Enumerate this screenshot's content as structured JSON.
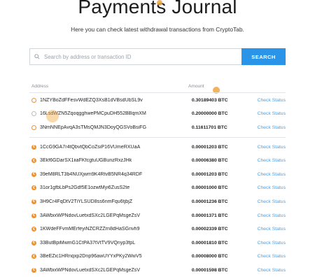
{
  "header": {
    "title": "Payments Journal",
    "subtitle": "Here you can check latest withdrawal transactions from CryptoTab."
  },
  "search": {
    "placeholder": "Search by address or transaction ID",
    "button_label": "SEARCH",
    "icon": "search-icon"
  },
  "table": {
    "columns": {
      "address": "Address",
      "amount": "Amount"
    },
    "check_label": "Check Status",
    "groups": [
      [
        {
          "coin": "btc",
          "address": "1NZYBoZdFFesvWdEZQ3XsB1dVBsdUbSL9v",
          "amount": "0.30189403 BTC"
        },
        {
          "coin": "pending",
          "address": "16LsdWZN5ZqoqgghwePMCpuDH552BBqmXM",
          "amount": "0.20000000 BTC"
        },
        {
          "coin": "btc",
          "address": "3NmNNEpAvqA3sTMsQMJN3DoyQGSVoBsiFG",
          "amount": "0.11611701 BTC"
        }
      ],
      [
        {
          "coin": "ctb",
          "address": "1CcG9GA7r4tQbvtQbCoZsiP16VUmeRXUaA",
          "amount": "0.00001203 BTC"
        },
        {
          "coin": "ctb",
          "address": "3Ekf6GDarSX1iiaFKfcgtuUGBunzRxzJHk",
          "amount": "0.00006380 BTC"
        },
        {
          "coin": "ctb",
          "address": "39eM8RLT3b4NUXjwm9K4RtvB5NR4q34RDF",
          "amount": "0.00001203 BTC"
        },
        {
          "coin": "ctb",
          "address": "31or1gfbLbPs2Gdf5E1ozwtMyi6ZusS2te",
          "amount": "0.00001000 BTC"
        },
        {
          "coin": "ctb",
          "address": "3H9Cr4FqDtV2TiYLSUD8ss6nmFqu6tjbjZ",
          "amount": "0.00001236 BTC"
        },
        {
          "coin": "ctb",
          "address": "3AWbixWPNdovLuetxdSXc2LGEPqMsgeZsV",
          "amount": "0.00001371 BTC"
        },
        {
          "coin": "ctb",
          "address": "1KWdeFFvmMErfeyiNZCRZZrn8dHaSGnvh9",
          "amount": "0.00002339 BTC"
        },
        {
          "coin": "ctb",
          "address": "33ButBpiMwmG1CtPA37tVtTV9VQnyp3fpL",
          "amount": "0.00001810 BTC"
        },
        {
          "coin": "ctb",
          "address": "3BeEZic1HRnqxp2Dnp96awUYYxPKy2WwV5",
          "amount": "0.00008000 BTC"
        },
        {
          "coin": "ctb",
          "address": "3AWbixWPNdovLuetxdSXc2LGEPqMsgeZsV",
          "amount": "0.00001598 BTC"
        }
      ]
    ]
  },
  "colors": {
    "accent": "#2a95e8",
    "link": "#4aa0e6",
    "coin_orange": "#f0922c"
  }
}
